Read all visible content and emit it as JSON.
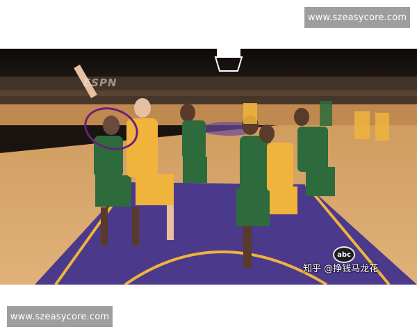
{
  "watermarks": {
    "top": "www.szeasycore.com",
    "bottom": "www.szeasycore.com"
  },
  "photo": {
    "broadcast_logo": "ESPN",
    "network_logo": "abc",
    "credit": "知乎 @挣钱马龙花",
    "colors": {
      "court_wood": "#d9a86a",
      "paint_purple": "#4b3a8c",
      "celtics_green": "#2e6b3c",
      "lakers_gold": "#f0b43c",
      "annotation_circle": "#6a1f7a"
    }
  }
}
